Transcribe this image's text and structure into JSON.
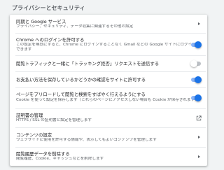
{
  "section": {
    "title": "プライバシーとセキュリティ"
  },
  "rows": [
    {
      "label": "同期と Google サービス",
      "sub": "プライバシー、セキュリティ、データ収集に関連するその他の設定",
      "control": "chevron-right-icon"
    },
    {
      "label": "Chrome へのログインを許可する",
      "sub": "この設定を無効にすると、Chrome にログインすることなく Gmail などの Google サイトにログインできます",
      "control": "toggle",
      "toggle_on": true
    },
    {
      "label": "閲覧トラフィックと一緒に「トラッキング拒否」リクエストを送信する",
      "control": "toggle",
      "toggle_on": false
    },
    {
      "label": "お支払い方法を保存しているかどうかの確認をサイトに許可する",
      "control": "toggle",
      "toggle_on": true
    },
    {
      "label": "ページをプリロードして閲覧と検索をすばやく行えるようにする",
      "sub": "Cookie を使って設定を保存します（これらのページにアクセスしない場合も Cookie が保存されます）",
      "control": "toggle",
      "toggle_on": true
    },
    {
      "label": "証明書の管理",
      "sub": "HTTPS / SSL の証明書と設定を管理します",
      "control": "open-in-new-icon"
    },
    {
      "label": "コンテンツの設定",
      "sub": "ウェブサイトに使用を許可する情報や、表示してもよいコンテンツを管理します",
      "control": "chevron-right-icon"
    },
    {
      "label": "閲覧履歴データを削除する",
      "sub": "閲覧履歴、Cookie、キャッシュなどを削除します",
      "control": "chevron-right-icon"
    }
  ],
  "colors": {
    "accent": "#1a73e8",
    "accent_track": "#8ab4f8",
    "background": "#f1f3f4",
    "card": "#ffffff"
  }
}
